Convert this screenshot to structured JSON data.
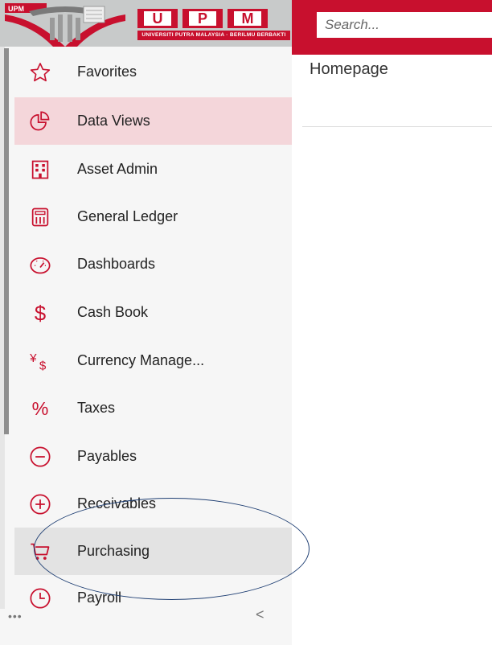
{
  "header": {
    "brand_letters": [
      "U",
      "P",
      "M"
    ],
    "brand_subtitle": "UNIVERSITI PUTRA MALAYSIA",
    "brand_tagline": "BERILMU BERBAKTI",
    "emblem_text": "UPM",
    "search": {
      "placeholder": "Search...",
      "value": ""
    },
    "accent_color": "#c8102e"
  },
  "sidebar": {
    "items": [
      {
        "label": "Favorites",
        "icon": "star-icon"
      },
      {
        "label": "Data Views",
        "icon": "pie-chart-icon",
        "state": "active"
      },
      {
        "label": "Asset Admin",
        "icon": "building-icon"
      },
      {
        "label": "General Ledger",
        "icon": "calculator-icon"
      },
      {
        "label": "Dashboards",
        "icon": "gauge-icon"
      },
      {
        "label": "Cash Book",
        "icon": "dollar-icon"
      },
      {
        "label": "Currency Manage...",
        "icon": "currency-icon"
      },
      {
        "label": "Taxes",
        "icon": "percent-icon"
      },
      {
        "label": "Payables",
        "icon": "minus-circle-icon"
      },
      {
        "label": "Receivables",
        "icon": "plus-circle-icon"
      },
      {
        "label": "Purchasing",
        "icon": "cart-icon",
        "state": "highlighted"
      },
      {
        "label": "Payroll",
        "icon": "clock-icon"
      }
    ],
    "more_label": "•••",
    "collapse_label": "<"
  },
  "main": {
    "title": "Homepage"
  }
}
